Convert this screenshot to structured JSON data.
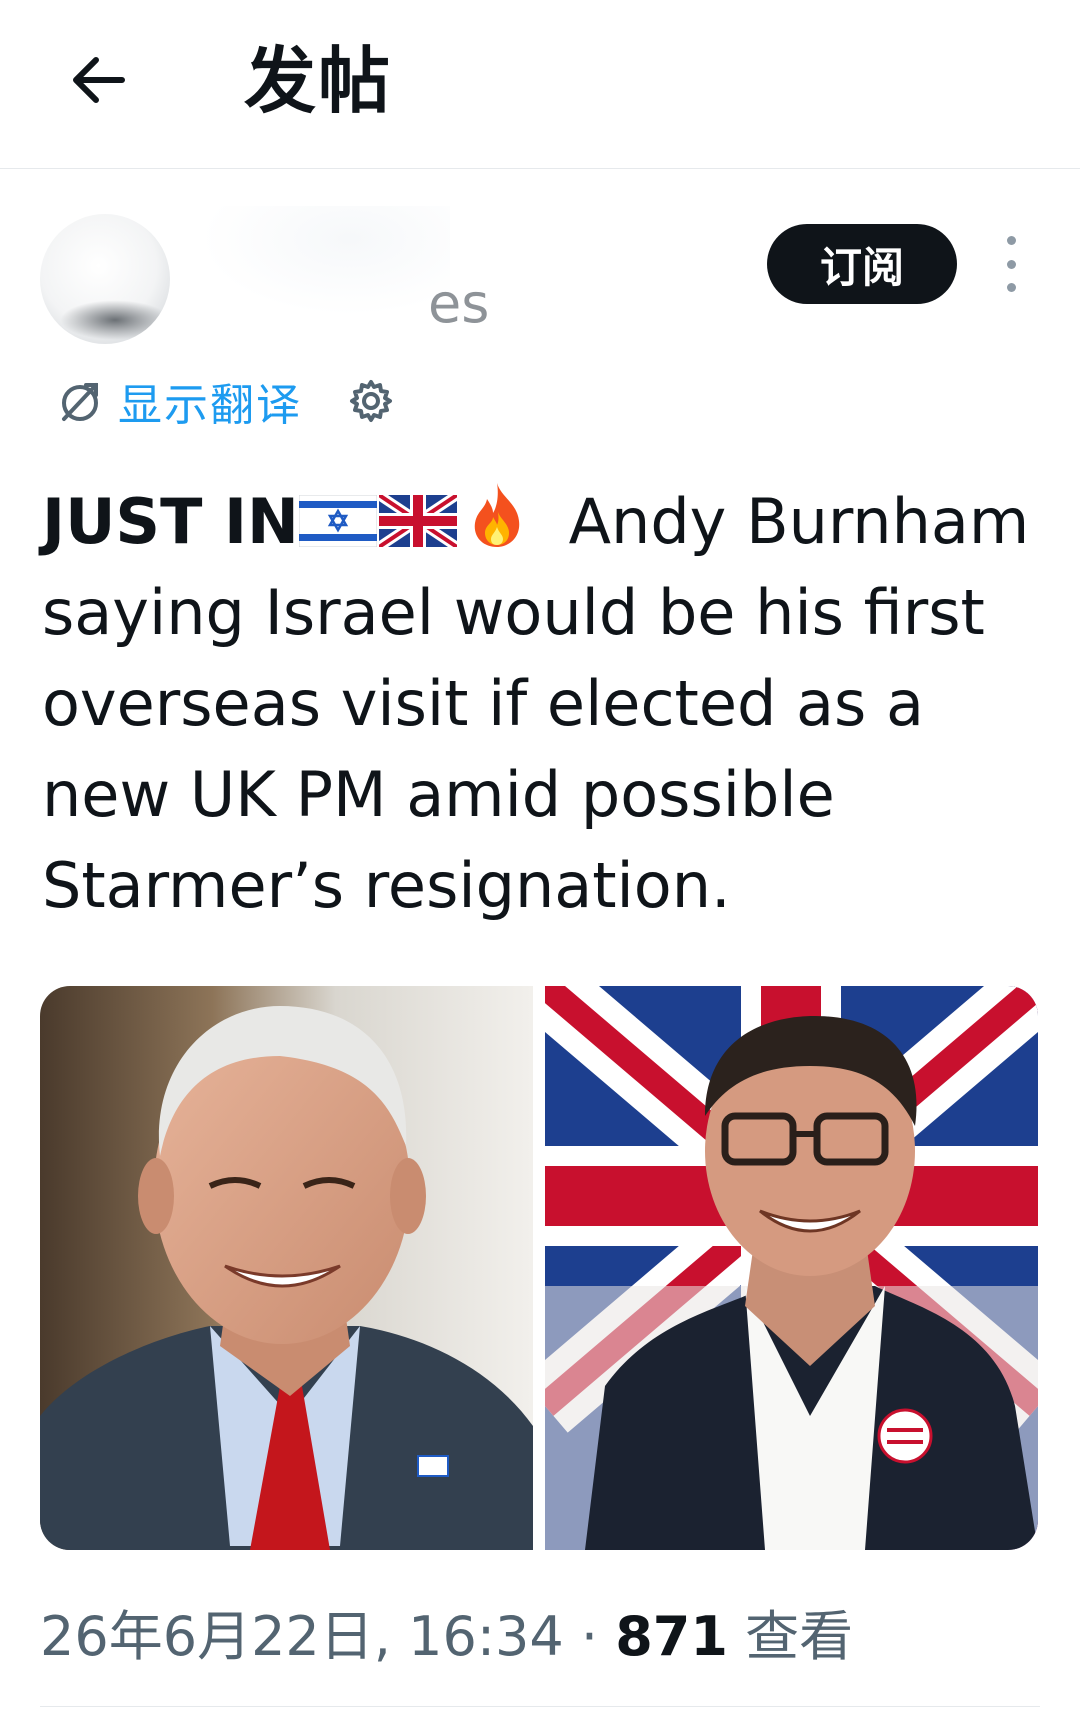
{
  "header": {
    "title": "发帖",
    "back_icon": "arrow-left-icon"
  },
  "author": {
    "name_visible_fragment": "es",
    "subscribe_label": "订阅",
    "more_icon": "more-vertical-icon"
  },
  "translate": {
    "label": "显示翻译",
    "icon": "translate-icon",
    "settings_icon": "gear-icon"
  },
  "tweet": {
    "lead": "JUST IN",
    "flags": [
      "israel-flag-icon",
      "uk-flag-icon",
      "fire-icon"
    ],
    "body": " Andy Burnham saying Israel would be his first overseas visit if elected as a new UK PM amid possible Starmer’s resignation."
  },
  "media": {
    "count": 2
  },
  "meta": {
    "datetime": "26年6月22日, 16:34",
    "separator": " · ",
    "views_count": "871",
    "views_label": " 查看"
  },
  "colors": {
    "link": "#1d9bf0",
    "text": "#0f1419",
    "secondary": "#536471",
    "button_bg": "#0f1419"
  }
}
